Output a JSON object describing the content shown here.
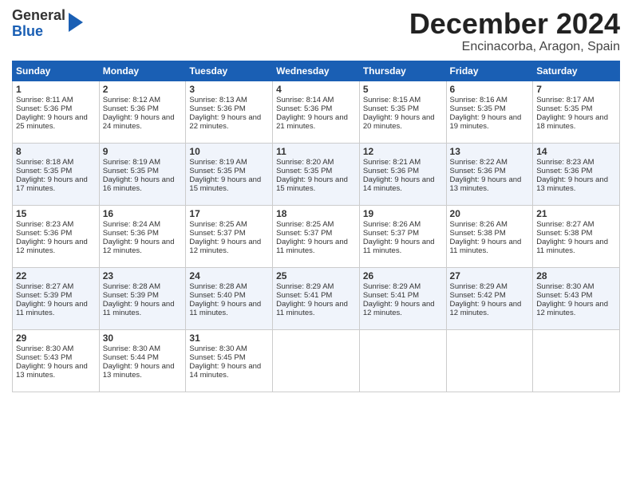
{
  "logo": {
    "line1": "General",
    "line2": "Blue"
  },
  "title": "December 2024",
  "location": "Encinacorba, Aragon, Spain",
  "days_of_week": [
    "Sunday",
    "Monday",
    "Tuesday",
    "Wednesday",
    "Thursday",
    "Friday",
    "Saturday"
  ],
  "weeks": [
    [
      {
        "day": "1",
        "sunrise": "Sunrise: 8:11 AM",
        "sunset": "Sunset: 5:36 PM",
        "daylight": "Daylight: 9 hours and 25 minutes."
      },
      {
        "day": "2",
        "sunrise": "Sunrise: 8:12 AM",
        "sunset": "Sunset: 5:36 PM",
        "daylight": "Daylight: 9 hours and 24 minutes."
      },
      {
        "day": "3",
        "sunrise": "Sunrise: 8:13 AM",
        "sunset": "Sunset: 5:36 PM",
        "daylight": "Daylight: 9 hours and 22 minutes."
      },
      {
        "day": "4",
        "sunrise": "Sunrise: 8:14 AM",
        "sunset": "Sunset: 5:36 PM",
        "daylight": "Daylight: 9 hours and 21 minutes."
      },
      {
        "day": "5",
        "sunrise": "Sunrise: 8:15 AM",
        "sunset": "Sunset: 5:35 PM",
        "daylight": "Daylight: 9 hours and 20 minutes."
      },
      {
        "day": "6",
        "sunrise": "Sunrise: 8:16 AM",
        "sunset": "Sunset: 5:35 PM",
        "daylight": "Daylight: 9 hours and 19 minutes."
      },
      {
        "day": "7",
        "sunrise": "Sunrise: 8:17 AM",
        "sunset": "Sunset: 5:35 PM",
        "daylight": "Daylight: 9 hours and 18 minutes."
      }
    ],
    [
      {
        "day": "8",
        "sunrise": "Sunrise: 8:18 AM",
        "sunset": "Sunset: 5:35 PM",
        "daylight": "Daylight: 9 hours and 17 minutes."
      },
      {
        "day": "9",
        "sunrise": "Sunrise: 8:19 AM",
        "sunset": "Sunset: 5:35 PM",
        "daylight": "Daylight: 9 hours and 16 minutes."
      },
      {
        "day": "10",
        "sunrise": "Sunrise: 8:19 AM",
        "sunset": "Sunset: 5:35 PM",
        "daylight": "Daylight: 9 hours and 15 minutes."
      },
      {
        "day": "11",
        "sunrise": "Sunrise: 8:20 AM",
        "sunset": "Sunset: 5:35 PM",
        "daylight": "Daylight: 9 hours and 15 minutes."
      },
      {
        "day": "12",
        "sunrise": "Sunrise: 8:21 AM",
        "sunset": "Sunset: 5:36 PM",
        "daylight": "Daylight: 9 hours and 14 minutes."
      },
      {
        "day": "13",
        "sunrise": "Sunrise: 8:22 AM",
        "sunset": "Sunset: 5:36 PM",
        "daylight": "Daylight: 9 hours and 13 minutes."
      },
      {
        "day": "14",
        "sunrise": "Sunrise: 8:23 AM",
        "sunset": "Sunset: 5:36 PM",
        "daylight": "Daylight: 9 hours and 13 minutes."
      }
    ],
    [
      {
        "day": "15",
        "sunrise": "Sunrise: 8:23 AM",
        "sunset": "Sunset: 5:36 PM",
        "daylight": "Daylight: 9 hours and 12 minutes."
      },
      {
        "day": "16",
        "sunrise": "Sunrise: 8:24 AM",
        "sunset": "Sunset: 5:36 PM",
        "daylight": "Daylight: 9 hours and 12 minutes."
      },
      {
        "day": "17",
        "sunrise": "Sunrise: 8:25 AM",
        "sunset": "Sunset: 5:37 PM",
        "daylight": "Daylight: 9 hours and 12 minutes."
      },
      {
        "day": "18",
        "sunrise": "Sunrise: 8:25 AM",
        "sunset": "Sunset: 5:37 PM",
        "daylight": "Daylight: 9 hours and 11 minutes."
      },
      {
        "day": "19",
        "sunrise": "Sunrise: 8:26 AM",
        "sunset": "Sunset: 5:37 PM",
        "daylight": "Daylight: 9 hours and 11 minutes."
      },
      {
        "day": "20",
        "sunrise": "Sunrise: 8:26 AM",
        "sunset": "Sunset: 5:38 PM",
        "daylight": "Daylight: 9 hours and 11 minutes."
      },
      {
        "day": "21",
        "sunrise": "Sunrise: 8:27 AM",
        "sunset": "Sunset: 5:38 PM",
        "daylight": "Daylight: 9 hours and 11 minutes."
      }
    ],
    [
      {
        "day": "22",
        "sunrise": "Sunrise: 8:27 AM",
        "sunset": "Sunset: 5:39 PM",
        "daylight": "Daylight: 9 hours and 11 minutes."
      },
      {
        "day": "23",
        "sunrise": "Sunrise: 8:28 AM",
        "sunset": "Sunset: 5:39 PM",
        "daylight": "Daylight: 9 hours and 11 minutes."
      },
      {
        "day": "24",
        "sunrise": "Sunrise: 8:28 AM",
        "sunset": "Sunset: 5:40 PM",
        "daylight": "Daylight: 9 hours and 11 minutes."
      },
      {
        "day": "25",
        "sunrise": "Sunrise: 8:29 AM",
        "sunset": "Sunset: 5:41 PM",
        "daylight": "Daylight: 9 hours and 11 minutes."
      },
      {
        "day": "26",
        "sunrise": "Sunrise: 8:29 AM",
        "sunset": "Sunset: 5:41 PM",
        "daylight": "Daylight: 9 hours and 12 minutes."
      },
      {
        "day": "27",
        "sunrise": "Sunrise: 8:29 AM",
        "sunset": "Sunset: 5:42 PM",
        "daylight": "Daylight: 9 hours and 12 minutes."
      },
      {
        "day": "28",
        "sunrise": "Sunrise: 8:30 AM",
        "sunset": "Sunset: 5:43 PM",
        "daylight": "Daylight: 9 hours and 12 minutes."
      }
    ],
    [
      {
        "day": "29",
        "sunrise": "Sunrise: 8:30 AM",
        "sunset": "Sunset: 5:43 PM",
        "daylight": "Daylight: 9 hours and 13 minutes."
      },
      {
        "day": "30",
        "sunrise": "Sunrise: 8:30 AM",
        "sunset": "Sunset: 5:44 PM",
        "daylight": "Daylight: 9 hours and 13 minutes."
      },
      {
        "day": "31",
        "sunrise": "Sunrise: 8:30 AM",
        "sunset": "Sunset: 5:45 PM",
        "daylight": "Daylight: 9 hours and 14 minutes."
      },
      null,
      null,
      null,
      null
    ]
  ]
}
